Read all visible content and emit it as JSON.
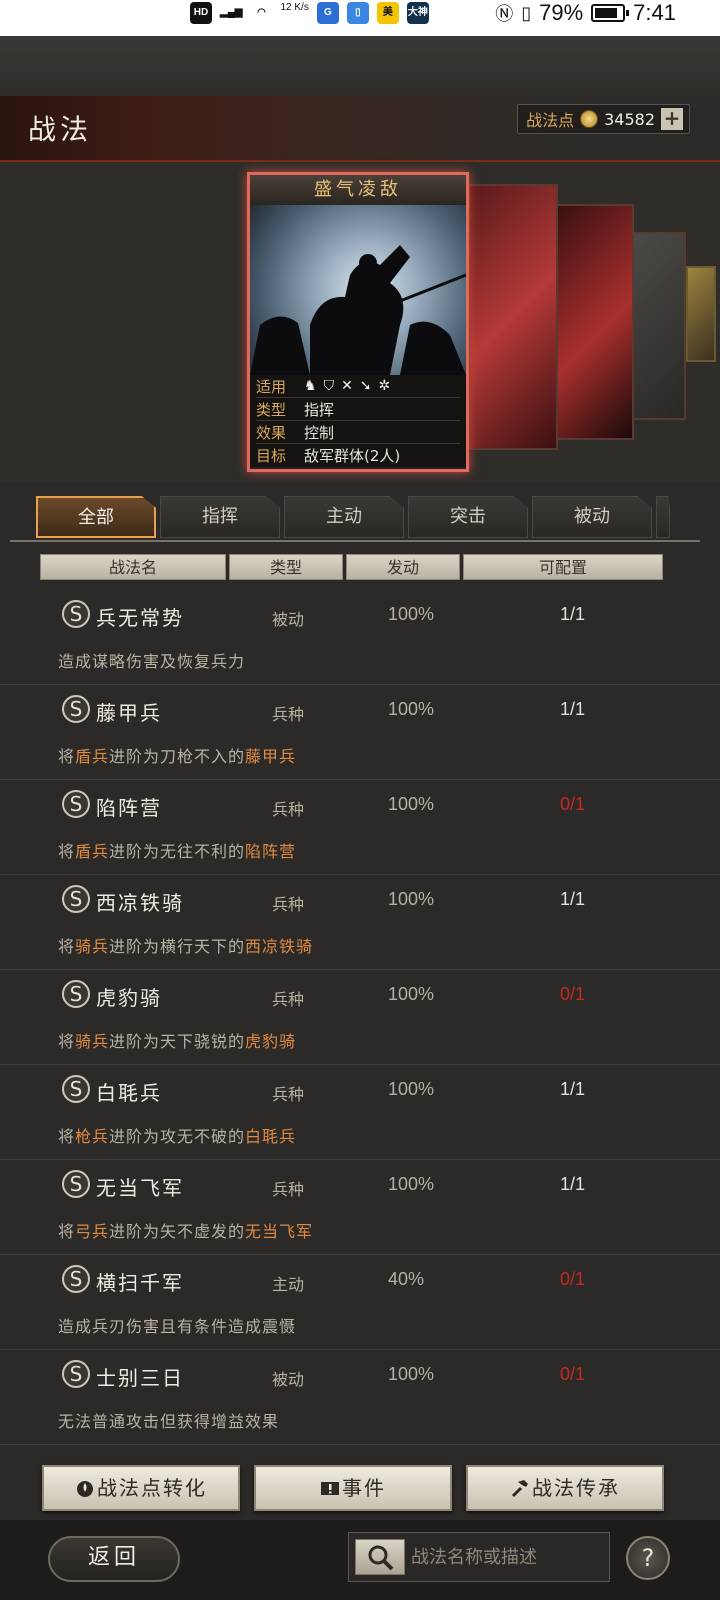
{
  "status_bar": {
    "left_icons": [
      "HD",
      "4G",
      "signal",
      "wifi",
      "12 K/s",
      "app-g",
      "app-box",
      "美",
      "大神"
    ],
    "net_speed": "12\nK/s",
    "battery_pct": "79%",
    "time": "7:41"
  },
  "header": {
    "title": "战法",
    "points_label": "战法点",
    "points_value": "34582",
    "plus_label": "+"
  },
  "card": {
    "title": "盛气凌敌",
    "rows": [
      {
        "key": "适用",
        "value": ""
      },
      {
        "key": "类型",
        "value": "指挥"
      },
      {
        "key": "效果",
        "value": "控制"
      },
      {
        "key": "目标",
        "value": "敌军群体(2人)"
      }
    ],
    "unit_icons": [
      "cavalry-icon",
      "shield-icon",
      "bow-icon",
      "spear-icon",
      "wheel-icon"
    ]
  },
  "tabs": [
    {
      "label": "全部",
      "active": true
    },
    {
      "label": "指挥",
      "active": false
    },
    {
      "label": "主动",
      "active": false
    },
    {
      "label": "突击",
      "active": false
    },
    {
      "label": "被动",
      "active": false
    }
  ],
  "columns": [
    "战法名",
    "类型",
    "发动",
    "可配置"
  ],
  "tactics": [
    {
      "grade": "S",
      "name": "兵无常势",
      "type": "被动",
      "rate": "100%",
      "cfg": "1/1",
      "cfg_zero": false,
      "desc": [
        {
          "t": "造成谋略伤害及恢复兵力",
          "hl": false
        }
      ]
    },
    {
      "grade": "S",
      "name": "藤甲兵",
      "type": "兵种",
      "rate": "100%",
      "cfg": "1/1",
      "cfg_zero": false,
      "desc": [
        {
          "t": "将",
          "hl": false
        },
        {
          "t": "盾兵",
          "hl": true
        },
        {
          "t": "进阶为刀枪不入的",
          "hl": false
        },
        {
          "t": "藤甲兵",
          "hl": true
        }
      ]
    },
    {
      "grade": "S",
      "name": "陷阵营",
      "type": "兵种",
      "rate": "100%",
      "cfg": "0/1",
      "cfg_zero": true,
      "desc": [
        {
          "t": "将",
          "hl": false
        },
        {
          "t": "盾兵",
          "hl": true
        },
        {
          "t": "进阶为无往不利的",
          "hl": false
        },
        {
          "t": "陷阵营",
          "hl": true
        }
      ]
    },
    {
      "grade": "S",
      "name": "西凉铁骑",
      "type": "兵种",
      "rate": "100%",
      "cfg": "1/1",
      "cfg_zero": false,
      "desc": [
        {
          "t": "将",
          "hl": false
        },
        {
          "t": "骑兵",
          "hl": true
        },
        {
          "t": "进阶为横行天下的",
          "hl": false
        },
        {
          "t": "西凉铁骑",
          "hl": true
        }
      ]
    },
    {
      "grade": "S",
      "name": "虎豹骑",
      "type": "兵种",
      "rate": "100%",
      "cfg": "0/1",
      "cfg_zero": true,
      "desc": [
        {
          "t": "将",
          "hl": false
        },
        {
          "t": "骑兵",
          "hl": true
        },
        {
          "t": "进阶为天下骁锐的",
          "hl": false
        },
        {
          "t": "虎豹骑",
          "hl": true
        }
      ]
    },
    {
      "grade": "S",
      "name": "白毦兵",
      "type": "兵种",
      "rate": "100%",
      "cfg": "1/1",
      "cfg_zero": false,
      "desc": [
        {
          "t": "将",
          "hl": false
        },
        {
          "t": "枪兵",
          "hl": true
        },
        {
          "t": "进阶为攻无不破的",
          "hl": false
        },
        {
          "t": "白毦兵",
          "hl": true
        }
      ]
    },
    {
      "grade": "S",
      "name": "无当飞军",
      "type": "兵种",
      "rate": "100%",
      "cfg": "1/1",
      "cfg_zero": false,
      "desc": [
        {
          "t": "将",
          "hl": false
        },
        {
          "t": "弓兵",
          "hl": true
        },
        {
          "t": "进阶为矢不虚发的",
          "hl": false
        },
        {
          "t": "无当飞军",
          "hl": true
        }
      ]
    },
    {
      "grade": "S",
      "name": "横扫千军",
      "type": "主动",
      "rate": "40%",
      "cfg": "0/1",
      "cfg_zero": true,
      "desc": [
        {
          "t": "造成兵刃伤害且有条件造成震慑",
          "hl": false
        }
      ]
    },
    {
      "grade": "S",
      "name": "士别三日",
      "type": "被动",
      "rate": "100%",
      "cfg": "0/1",
      "cfg_zero": true,
      "desc": [
        {
          "t": "无法普通攻击但获得增益效果",
          "hl": false
        }
      ]
    }
  ],
  "actions": {
    "convert": "战法点转化",
    "events": "事件",
    "inherit": "战法传承"
  },
  "footer": {
    "back": "返回",
    "search_placeholder": "战法名称或描述",
    "help": "?"
  },
  "colors": {
    "accent_orange": "#e08a42",
    "zero_red": "#c42a1f",
    "card_border": "#e06a5e"
  }
}
